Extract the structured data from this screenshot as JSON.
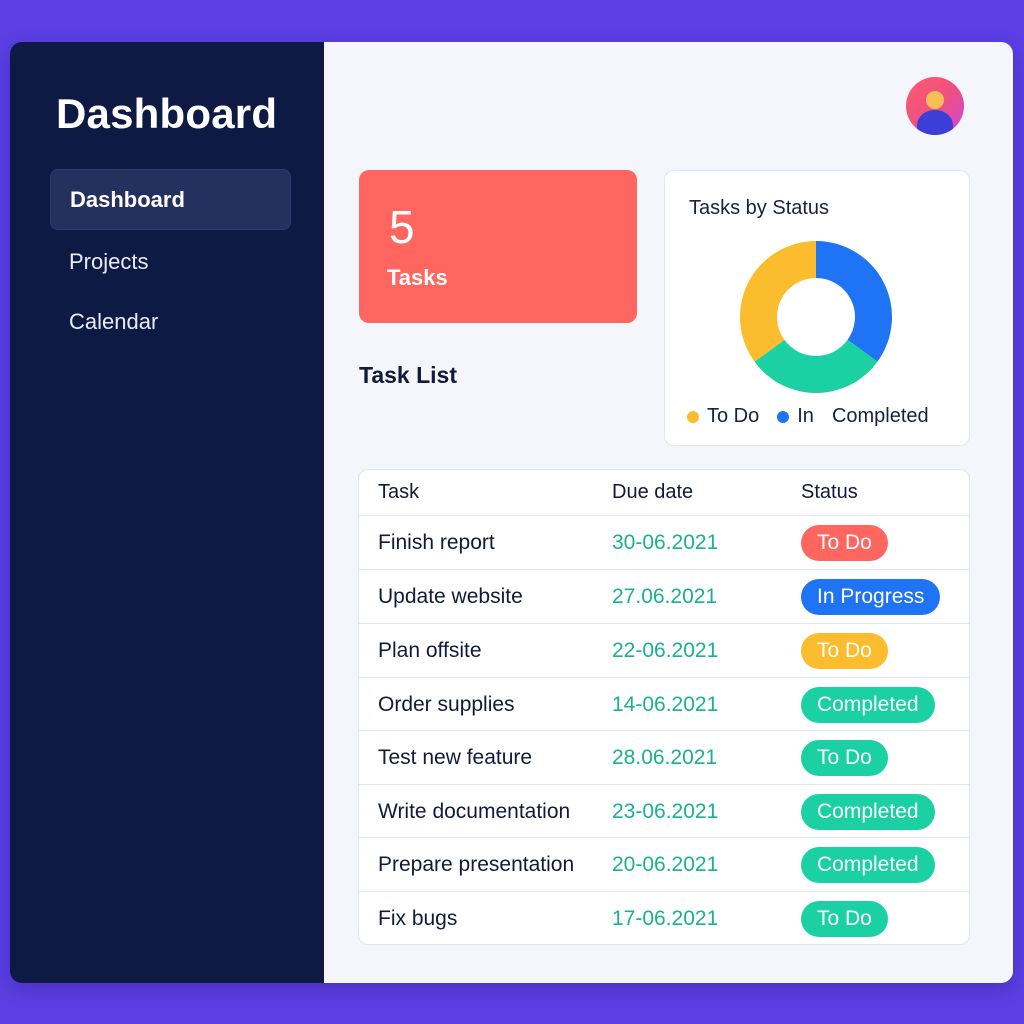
{
  "sidebar": {
    "title": "Dashboard",
    "items": [
      {
        "label": "Dashboard",
        "active": true
      },
      {
        "label": "Projects",
        "active": false
      },
      {
        "label": "Calendar",
        "active": false
      }
    ]
  },
  "header": {
    "avatar_icon": "user-avatar-icon"
  },
  "stat": {
    "value": "5",
    "label": "Tasks",
    "color": "#ff6660"
  },
  "chart": {
    "title": "Tasks by Status",
    "legend": [
      {
        "label": "To Do",
        "color": "#fbbd2e"
      },
      {
        "label": "In",
        "color": "#1f74f5"
      },
      {
        "label": "Completed",
        "color": ""
      }
    ]
  },
  "chart_data": {
    "type": "pie",
    "title": "Tasks by Status",
    "categories": [
      "In",
      "Completed",
      "To Do"
    ],
    "values": [
      35,
      30,
      35
    ],
    "colors": [
      "#1f74f5",
      "#1bd1a3",
      "#fbbd2e"
    ],
    "donut": true,
    "legend_placement": "bottom"
  },
  "task_list": {
    "title": "Task List",
    "columns": [
      "Task",
      "Due date",
      "Status"
    ],
    "rows": [
      {
        "task": "Finish report",
        "due": "30-06.2021",
        "status": "To Do",
        "status_color": "#ff6660"
      },
      {
        "task": "Update website",
        "due": "27.06.2021",
        "status": "In Progress",
        "status_color": "#1f74f5"
      },
      {
        "task": "Plan offsite",
        "due": "22-06.2021",
        "status": "To Do",
        "status_color": "#fbbd2e"
      },
      {
        "task": "Order supplies",
        "due": "14-06.2021",
        "status": "Completed",
        "status_color": "#1bd1a3"
      },
      {
        "task": "Test new feature",
        "due": "28.06.2021",
        "status": "To Do",
        "status_color": "#1bd1a3"
      },
      {
        "task": "Write documentation",
        "due": "23-06.2021",
        "status": "Completed",
        "status_color": "#1bd1a3"
      },
      {
        "task": "Prepare presentation",
        "due": "20-06.2021",
        "status": "Completed",
        "status_color": "#1bd1a3"
      },
      {
        "task": "Fix bugs",
        "due": "17-06.2021",
        "status": "To Do",
        "status_color": "#1bd1a3"
      }
    ]
  },
  "colors": {
    "sidebar_bg": "#0f1a44",
    "page_bg": "#5b3fe4",
    "main_bg": "#f5f6fb",
    "date_text": "#19b18f"
  }
}
